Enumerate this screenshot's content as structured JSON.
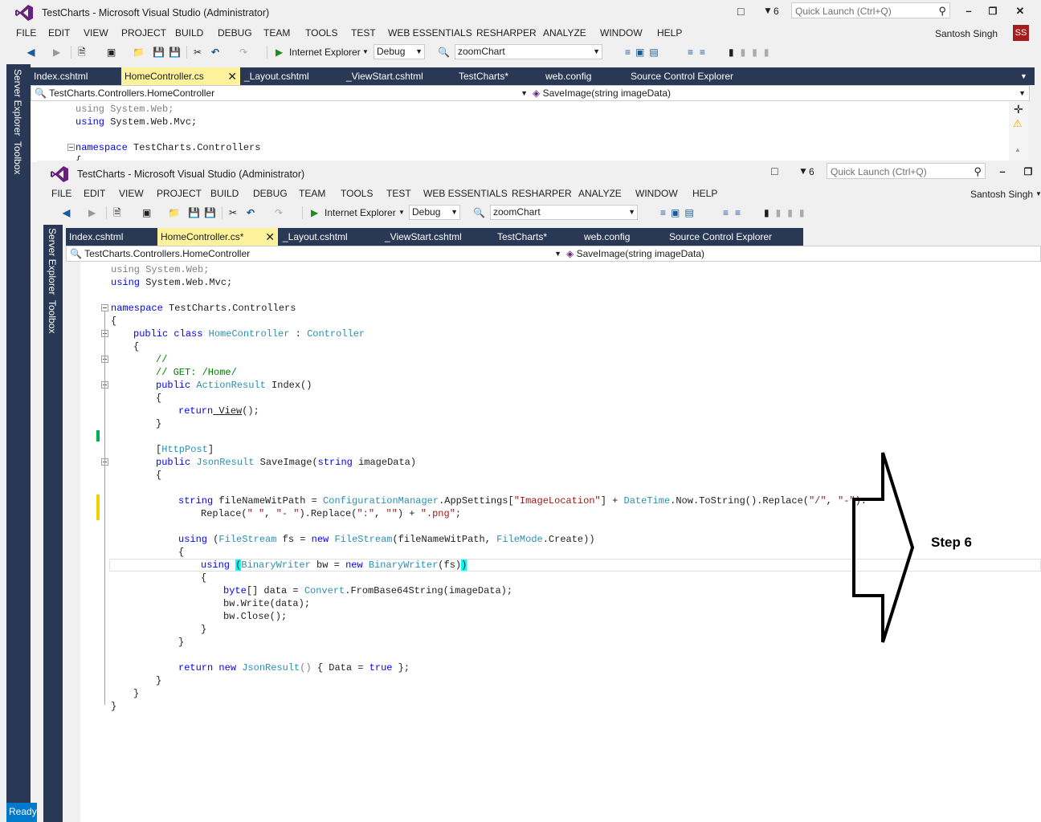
{
  "back_window": {
    "title": "TestCharts - Microsoft Visual Studio (Administrator)",
    "notification_count": "6",
    "quick_launch_placeholder": "Quick Launch (Ctrl+Q)",
    "menu": [
      "FILE",
      "EDIT",
      "VIEW",
      "PROJECT",
      "BUILD",
      "DEBUG",
      "TEAM",
      "TOOLS",
      "TEST",
      "WEB ESSENTIALS",
      "RESHARPER",
      "ANALYZE",
      "WINDOW",
      "HELP"
    ],
    "user_name": "Santosh Singh",
    "user_initials": "SS",
    "browser": "Internet Explorer",
    "config": "Debug",
    "find": "zoomChart",
    "tabs": [
      "Index.cshtml",
      "HomeController.cs",
      "_Layout.cshtml",
      "_ViewStart.cshtml",
      "TestCharts*",
      "web.config",
      "Source Control Explorer"
    ],
    "nav_class": "TestCharts.Controllers.HomeController",
    "nav_member": "SaveImage(string imageData)",
    "side": [
      "Server Explorer",
      "Toolbox"
    ],
    "code": {
      "l1a": "using",
      "l1b": " System.Web;",
      "l2a": "using",
      "l2b": " System.Web.Mvc;",
      "l3a": "namespace",
      "l3b": " TestCharts.Controllers",
      "l4": "{"
    },
    "status": "Ready"
  },
  "front_window": {
    "title": "TestCharts - Microsoft Visual Studio (Administrator)",
    "notification_count": "6",
    "quick_launch_placeholder": "Quick Launch (Ctrl+Q)",
    "menu": [
      "FILE",
      "EDIT",
      "VIEW",
      "PROJECT",
      "BUILD",
      "DEBUG",
      "TEAM",
      "TOOLS",
      "TEST",
      "WEB ESSENTIALS",
      "RESHARPER",
      "ANALYZE",
      "WINDOW",
      "HELP"
    ],
    "user_name": "Santosh Singh",
    "browser": "Internet Explorer",
    "config": "Debug",
    "find": "zoomChart",
    "tabs": [
      "Index.cshtml",
      "HomeController.cs*",
      "_Layout.cshtml",
      "_ViewStart.cshtml",
      "TestCharts*",
      "web.config",
      "Source Control Explorer"
    ],
    "nav_class": "TestCharts.Controllers.HomeController",
    "nav_member": "SaveImage(string imageData)",
    "side": [
      "Server Explorer",
      "Toolbox"
    ],
    "code": {
      "using1_kw": "using",
      "using1_ns": " System.Web;",
      "using2_kw": "using",
      "using2_ns": " System.Web.Mvc;",
      "ns_kw": "namespace",
      "ns_name": " TestCharts.Controllers",
      "open1": "{",
      "class_kw1": "public",
      "class_kw2": " class",
      "class_name": " HomeController",
      "class_colon": " : ",
      "class_base": "Controller",
      "open2": "{",
      "cm1": "//",
      "cm2": "// GET: /Home/",
      "idx_kw": "public",
      "idx_type": " ActionResult",
      "idx_name": " Index()",
      "open3": "{",
      "ret_kw": "return",
      "ret_call": " View",
      "ret_end": "();",
      "close3": "}",
      "attr_open": "[",
      "attr_name": "HttpPost",
      "attr_close": "]",
      "save_kw": "public",
      "save_type": " JsonResult",
      "save_name": " SaveImage(",
      "save_kw2": "string",
      "save_param": " imageData)",
      "open4": "{",
      "s_kw": "string",
      "s_var": " fileNameWitPath = ",
      "s_cm": "ConfigurationManager",
      "s_app": ".AppSettings[",
      "s_key": "\"ImageLocation\"",
      "s_mid": "] + ",
      "s_dt": "DateTime",
      "s_now": ".Now.ToString().Replace(",
      "s_a1": "\"/\"",
      "s_comma": ", ",
      "s_a2": "\"-\"",
      "s_end": ").",
      "r_start": "Replace(",
      "r_a1": "\" \"",
      "r_comma1": ", ",
      "r_a2": "\"- \"",
      "r_mid": ").Replace(",
      "r_a3": "\":\"",
      "r_comma2": ", ",
      "r_a4": "\"\"",
      "r_plus": ") + ",
      "r_a5": "\".png\"",
      "r_end": ";",
      "fs_kw": "using",
      "fs_p": " (",
      "fs_type": "FileStream",
      "fs_var": " fs = ",
      "fs_new": "new",
      "fs_type2": " FileStream",
      "fs_args": "(fileNameWitPath, ",
      "fs_mode": "FileMode",
      "fs_end": ".Create))",
      "open5": "{",
      "bw_kw": "using",
      "bw_sp": " ",
      "bw_p": "(",
      "bw_type": "BinaryWriter",
      "bw_var": " bw = ",
      "bw_new": "new",
      "bw_type2": " BinaryWriter",
      "bw_args": "(fs)",
      "bw_end": ")",
      "open6": "{",
      "by_kw": "byte",
      "by_rest": "[] data = ",
      "by_cv": "Convert",
      "by_end": ".FromBase64String(imageData);",
      "w1": "bw.Write(data);",
      "w2": "bw.Close();",
      "close6": "}",
      "close5": "}",
      "jr_kw": "return",
      "jr_new": " new",
      "jr_type": " JsonResult",
      "jr_p": "()",
      "jr_mid": " { Data = ",
      "jr_true": "true",
      "jr_end": " };",
      "close4": "}",
      "close2": "}",
      "close1": "}"
    }
  },
  "annotation": {
    "step_label": "Step 6"
  }
}
